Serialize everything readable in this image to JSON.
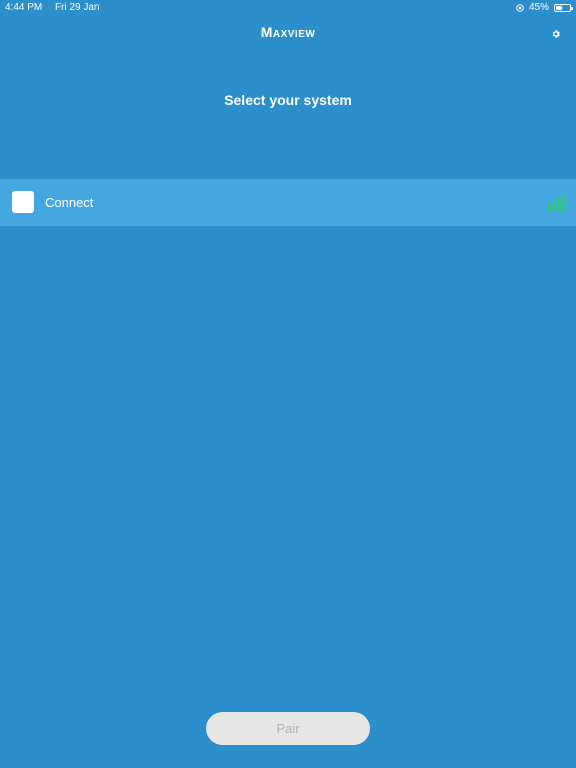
{
  "status_bar": {
    "time": "4:44 PM",
    "date": "Fri 29 Jan",
    "battery_percent_text": "45%",
    "battery_level": 0.45,
    "icons": [
      "orientation-lock-icon",
      "battery-icon"
    ]
  },
  "nav": {
    "title": "Maxview",
    "settings_icon": "gear-icon"
  },
  "page": {
    "heading": "Select your system"
  },
  "devices": [
    {
      "label": "Connect",
      "selected": false,
      "signal_bars": 4,
      "signal_color": "#2ecc71"
    }
  ],
  "footer": {
    "pair_label": "Pair",
    "pair_enabled": false
  },
  "colors": {
    "background": "#2b8fcb",
    "row_highlight": "#45a7e0",
    "signal": "#2ecc71",
    "button_bg": "#e6e6e6",
    "button_text_disabled": "#b5b5b5"
  }
}
